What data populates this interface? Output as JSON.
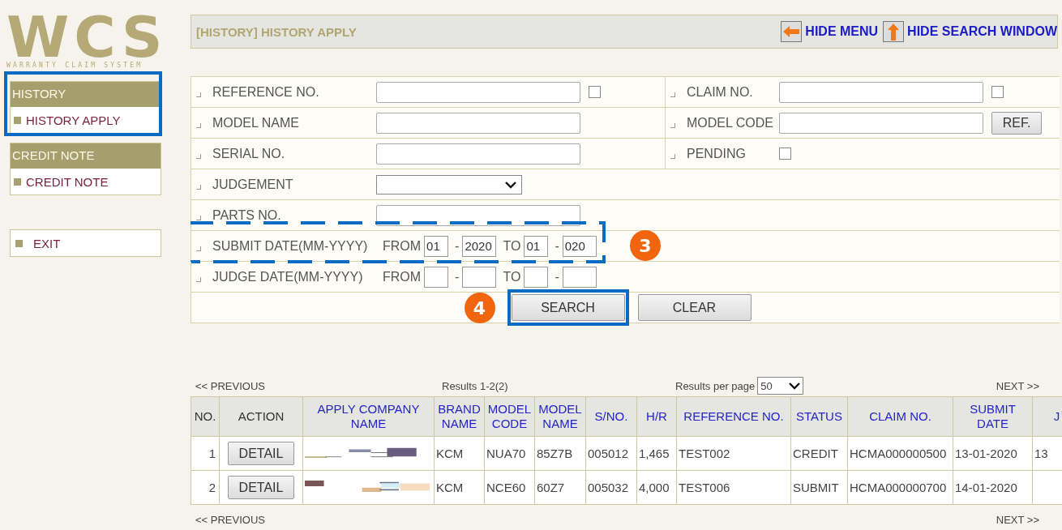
{
  "sidebar": {
    "logo": {
      "title": "WCS",
      "subtitle": "WARRANTY CLAIM SYSTEM"
    },
    "groups": [
      {
        "title": "HISTORY",
        "highlighted": true,
        "items": [
          {
            "label": "HISTORY APPLY"
          }
        ]
      },
      {
        "title": "CREDIT NOTE",
        "highlighted": false,
        "items": [
          {
            "label": "CREDIT NOTE"
          }
        ]
      }
    ],
    "exit": {
      "label": "EXIT"
    }
  },
  "header": {
    "title": "[HISTORY] HISTORY APPLY",
    "actions": [
      {
        "label": "HIDE MENU",
        "kind": "left"
      },
      {
        "label": "HIDE SEARCH WINDOW",
        "kind": "up"
      }
    ]
  },
  "search_form": {
    "rows": [
      {
        "cells": [
          {
            "label": "REFERENCE NO.",
            "controls": [
              {
                "kind": "text"
              },
              {
                "kind": "checkbox",
                "checked": false
              }
            ]
          },
          {
            "label": "CLAIM NO.",
            "controls": [
              {
                "kind": "text"
              },
              {
                "kind": "checkbox",
                "checked": false
              }
            ]
          }
        ]
      },
      {
        "cells": [
          {
            "label": "MODEL NAME",
            "controls": [
              {
                "kind": "text"
              }
            ]
          },
          {
            "label": "MODEL CODE",
            "controls": [
              {
                "kind": "text"
              },
              {
                "kind": "button",
                "text": "REF."
              }
            ]
          }
        ]
      },
      {
        "cells": [
          {
            "label": "SERIAL NO.",
            "controls": [
              {
                "kind": "text"
              }
            ]
          },
          {
            "label": "PENDING",
            "controls": [
              {
                "kind": "checkbox",
                "checked": false
              }
            ]
          }
        ]
      },
      {
        "cells": [
          {
            "label": "JUDGEMENT",
            "controls": [
              {
                "kind": "select"
              }
            ]
          }
        ]
      },
      {
        "cells": [
          {
            "label": "PARTS NO.",
            "controls": [
              {
                "kind": "text"
              }
            ]
          }
        ]
      },
      {
        "highlighted": true,
        "badge": "3",
        "cells": [
          {
            "label": "SUBMIT DATE(MM-YYYY)",
            "controls": [
              {
                "kind": "word",
                "text": "FROM"
              },
              {
                "kind": "month",
                "value": "01"
              },
              {
                "kind": "word",
                "text": "-"
              },
              {
                "kind": "year",
                "value": "2020"
              },
              {
                "kind": "word",
                "text": "TO"
              },
              {
                "kind": "month",
                "value": "01"
              },
              {
                "kind": "word",
                "text": "-"
              },
              {
                "kind": "year",
                "value": "020"
              }
            ]
          }
        ]
      },
      {
        "highlighted": false,
        "cells": [
          {
            "label": "JUDGE DATE(MM-YYYY)",
            "controls": [
              {
                "kind": "word",
                "text": "FROM"
              },
              {
                "kind": "month"
              },
              {
                "kind": "word",
                "text": "-"
              },
              {
                "kind": "year"
              },
              {
                "kind": "word",
                "text": "TO"
              },
              {
                "kind": "month"
              },
              {
                "kind": "word",
                "text": "-"
              },
              {
                "kind": "year"
              }
            ]
          }
        ]
      }
    ],
    "buttons": [
      {
        "label": "SEARCH",
        "highlighted": true,
        "badge": "4"
      },
      {
        "label": "CLEAR",
        "highlighted": false
      }
    ]
  },
  "results": {
    "pager": {
      "previous": "<< PREVIOUS",
      "summary": "Results 1-2(2)",
      "per_page_label": "Results per page",
      "per_page": "50",
      "next": "NEXT >>"
    },
    "table": {
      "columns": [
        {
          "label": "NO.",
          "link": false
        },
        {
          "label": "ACTION",
          "link": false
        },
        {
          "label": "APPLY COMPANY NAME",
          "link": true
        },
        {
          "label": "BRAND NAME",
          "link": true
        },
        {
          "label": "MODEL CODE",
          "link": true
        },
        {
          "label": "MODEL NAME",
          "link": true
        },
        {
          "label": "S/NO.",
          "link": true
        },
        {
          "label": "H/R",
          "link": true
        },
        {
          "label": "REFERENCE NO.",
          "link": true
        },
        {
          "label": "STATUS",
          "link": true
        },
        {
          "label": "CLAIM NO.",
          "link": true
        },
        {
          "label": "SUBMIT DATE",
          "link": true
        },
        {
          "label": "J",
          "link": true
        }
      ],
      "rows": [
        {
          "cells": [
            "1",
            {
              "kind": "button",
              "text": "DETAIL"
            },
            {
              "kind": "redacted"
            },
            "KCM",
            "NUA70",
            "85Z7B",
            "005012",
            "1,465",
            "TEST002",
            "CREDIT",
            "HCMA000000500",
            "13-01-2020",
            "13"
          ]
        },
        {
          "cells": [
            "2",
            {
              "kind": "button",
              "text": "DETAIL"
            },
            {
              "kind": "redacted"
            },
            "KCM",
            "NCE60",
            "60Z7",
            "005032",
            "4,000",
            "TEST006",
            "SUBMIT",
            "HCMA000000700",
            "14-01-2020"
          ]
        }
      ]
    },
    "bottom_pager": {
      "previous": "<< PREVIOUS",
      "next": "NEXT >>"
    }
  }
}
